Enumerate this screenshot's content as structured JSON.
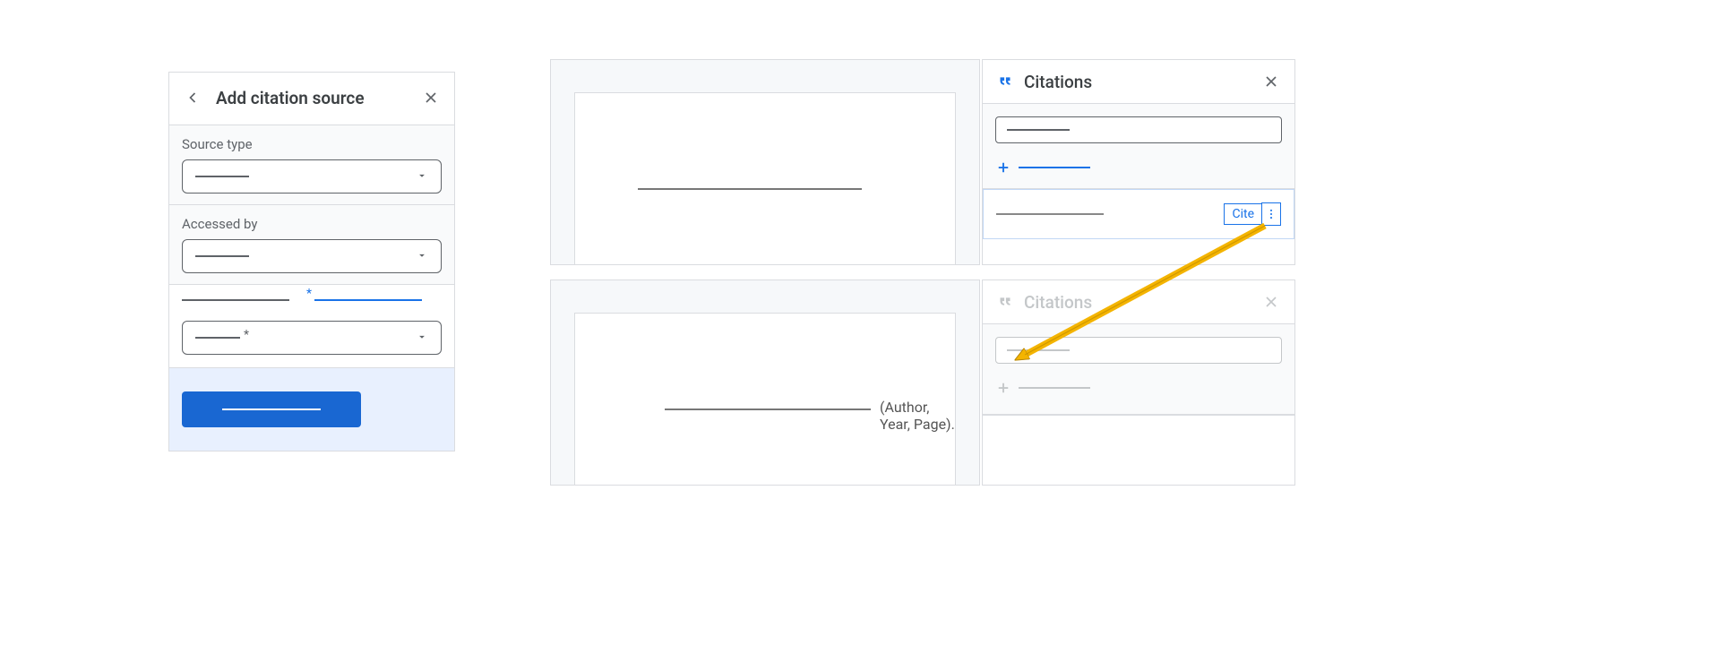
{
  "left_panel": {
    "title": "Add citation source",
    "source_type_label": "Source type",
    "accessed_by_label": "Accessed by"
  },
  "citations": {
    "title": "Citations",
    "cite_button": "Cite"
  },
  "doc": {
    "inserted_citation": "(Author, Year, Page)."
  }
}
